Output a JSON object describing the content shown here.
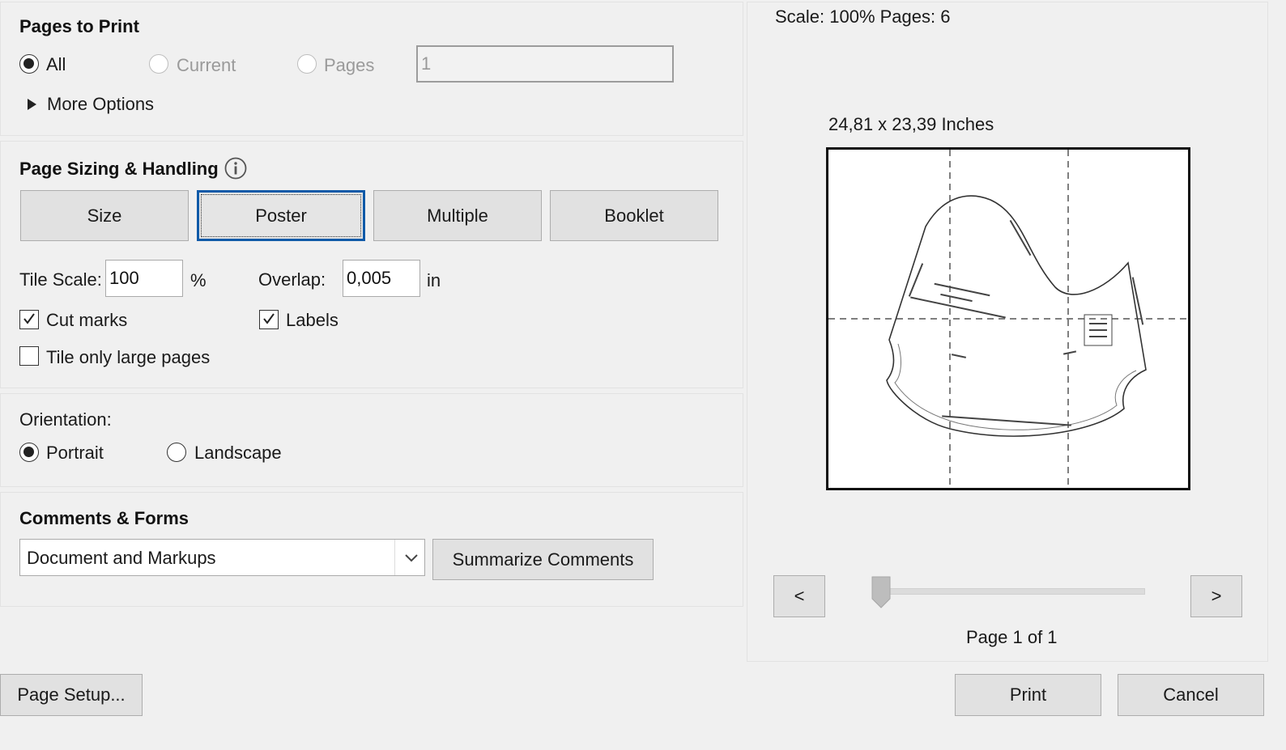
{
  "pages_to_print": {
    "heading": "Pages to Print",
    "radio_all": "All",
    "radio_current": "Current",
    "radio_pages": "Pages",
    "pages_value": "1",
    "more_options": "More Options"
  },
  "sizing": {
    "heading": "Page Sizing & Handling",
    "tabs": [
      "Size",
      "Poster",
      "Multiple",
      "Booklet"
    ],
    "selected_tab": "Poster",
    "tile_scale_label": "Tile Scale:",
    "tile_scale_value": "100",
    "tile_scale_unit": "%",
    "overlap_label": "Overlap:",
    "overlap_value": "0,005",
    "overlap_unit": "in",
    "cut_marks": "Cut marks",
    "cut_marks_checked": true,
    "labels": "Labels",
    "labels_checked": true,
    "tile_large": "Tile only large pages",
    "tile_large_checked": false
  },
  "orientation": {
    "heading": "Orientation:",
    "portrait": "Portrait",
    "landscape": "Landscape",
    "selected": "Portrait"
  },
  "comments": {
    "heading": "Comments & Forms",
    "select_value": "Document and Markups",
    "summarize": "Summarize Comments"
  },
  "preview": {
    "scale_info": "Scale: 100% Pages: 6",
    "dimensions": "24,81 x 23,39 Inches",
    "prev": "<",
    "next": ">",
    "page_info": "Page 1 of 1",
    "slider_position": 0
  },
  "footer": {
    "page_setup": "Page Setup...",
    "print": "Print",
    "cancel": "Cancel"
  },
  "icons": {
    "info": "info-icon",
    "triangle": "triangle-right-icon",
    "dropdown": "chevron-down-icon"
  }
}
